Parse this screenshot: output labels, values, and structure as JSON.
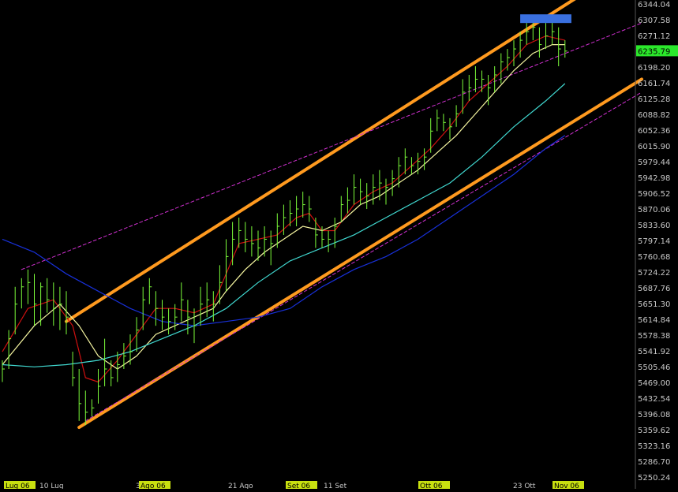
{
  "colors": {
    "background": "#000000",
    "price_bars": "#7CFC3A",
    "ma_fast": "#D01010",
    "ma_medium": "#F5F5A0",
    "ma_slow": "#40D8D0",
    "ma_long": "#1830D8",
    "channel": "#FF9A1F",
    "dashed_trend": "#D030D0",
    "axis_text": "#C8C8C8",
    "last_price_bg": "#2BE82B",
    "date_highlight_bg": "#C8E010",
    "target_box": "#3A70E0"
  },
  "chart_data": {
    "type": "line",
    "title": "",
    "xlabel": "",
    "ylabel": "",
    "ylim": [
      5250.24,
      6344.04
    ],
    "y_ticks": [
      "6344.04",
      "6307.58",
      "6271.12",
      "6235.79",
      "6198.20",
      "6161.74",
      "6125.28",
      "6088.82",
      "6052.36",
      "6015.90",
      "5979.44",
      "5942.98",
      "5906.52",
      "5870.06",
      "5833.60",
      "5797.14",
      "5760.68",
      "5724.22",
      "5687.76",
      "5651.30",
      "5614.84",
      "5578.38",
      "5541.92",
      "5505.46",
      "5469.00",
      "5432.54",
      "5396.08",
      "5359.62",
      "5323.16",
      "5286.70",
      "5250.24"
    ],
    "last_price": "6235.79",
    "x_tick_labels": [
      {
        "label": "Lug 06",
        "highlight": true
      },
      {
        "label": "10 Lug",
        "highlight": false
      },
      {
        "label": "31",
        "highlight": false
      },
      {
        "label": "Ago 06",
        "highlight": true
      },
      {
        "label": "21 Ago",
        "highlight": false
      },
      {
        "label": "Set 06",
        "highlight": true
      },
      {
        "label": "11 Set",
        "highlight": false
      },
      {
        "label": "Ott 06",
        "highlight": true
      },
      {
        "label": "23 Ott",
        "highlight": false
      },
      {
        "label": "Nov 06",
        "highlight": true
      }
    ],
    "x_range": [
      0,
      100
    ],
    "price_bars": [
      {
        "x": 0,
        "h": 5520,
        "l": 5470,
        "c": 5500
      },
      {
        "x": 1,
        "h": 5590,
        "l": 5500,
        "c": 5570
      },
      {
        "x": 2,
        "h": 5690,
        "l": 5580,
        "c": 5650
      },
      {
        "x": 3,
        "h": 5710,
        "l": 5640,
        "c": 5690
      },
      {
        "x": 4,
        "h": 5730,
        "l": 5650,
        "c": 5700
      },
      {
        "x": 5,
        "h": 5720,
        "l": 5600,
        "c": 5650
      },
      {
        "x": 6,
        "h": 5700,
        "l": 5600,
        "c": 5690
      },
      {
        "x": 7,
        "h": 5710,
        "l": 5630,
        "c": 5660
      },
      {
        "x": 8,
        "h": 5700,
        "l": 5600,
        "c": 5640
      },
      {
        "x": 9,
        "h": 5690,
        "l": 5590,
        "c": 5650
      },
      {
        "x": 10,
        "h": 5680,
        "l": 5580,
        "c": 5620
      },
      {
        "x": 11,
        "h": 5540,
        "l": 5460,
        "c": 5480
      },
      {
        "x": 12,
        "h": 5500,
        "l": 5380,
        "c": 5420
      },
      {
        "x": 13,
        "h": 5450,
        "l": 5370,
        "c": 5400
      },
      {
        "x": 14,
        "h": 5430,
        "l": 5390,
        "c": 5410
      },
      {
        "x": 15,
        "h": 5500,
        "l": 5420,
        "c": 5460
      },
      {
        "x": 16,
        "h": 5570,
        "l": 5460,
        "c": 5500
      },
      {
        "x": 17,
        "h": 5520,
        "l": 5460,
        "c": 5480
      },
      {
        "x": 18,
        "h": 5540,
        "l": 5470,
        "c": 5510
      },
      {
        "x": 19,
        "h": 5560,
        "l": 5500,
        "c": 5530
      },
      {
        "x": 20,
        "h": 5580,
        "l": 5510,
        "c": 5540
      },
      {
        "x": 21,
        "h": 5620,
        "l": 5540,
        "c": 5590
      },
      {
        "x": 22,
        "h": 5690,
        "l": 5590,
        "c": 5660
      },
      {
        "x": 23,
        "h": 5710,
        "l": 5650,
        "c": 5690
      },
      {
        "x": 24,
        "h": 5680,
        "l": 5600,
        "c": 5640
      },
      {
        "x": 25,
        "h": 5660,
        "l": 5590,
        "c": 5620
      },
      {
        "x": 26,
        "h": 5640,
        "l": 5580,
        "c": 5610
      },
      {
        "x": 27,
        "h": 5650,
        "l": 5590,
        "c": 5620
      },
      {
        "x": 28,
        "h": 5700,
        "l": 5610,
        "c": 5660
      },
      {
        "x": 29,
        "h": 5660,
        "l": 5580,
        "c": 5620
      },
      {
        "x": 30,
        "h": 5640,
        "l": 5560,
        "c": 5600
      },
      {
        "x": 31,
        "h": 5690,
        "l": 5600,
        "c": 5650
      },
      {
        "x": 32,
        "h": 5700,
        "l": 5620,
        "c": 5660
      },
      {
        "x": 33,
        "h": 5680,
        "l": 5610,
        "c": 5650
      },
      {
        "x": 34,
        "h": 5740,
        "l": 5650,
        "c": 5700
      },
      {
        "x": 35,
        "h": 5800,
        "l": 5680,
        "c": 5760
      },
      {
        "x": 36,
        "h": 5840,
        "l": 5740,
        "c": 5800
      },
      {
        "x": 37,
        "h": 5850,
        "l": 5780,
        "c": 5820
      },
      {
        "x": 38,
        "h": 5840,
        "l": 5770,
        "c": 5800
      },
      {
        "x": 39,
        "h": 5830,
        "l": 5760,
        "c": 5790
      },
      {
        "x": 40,
        "h": 5820,
        "l": 5750,
        "c": 5780
      },
      {
        "x": 41,
        "h": 5830,
        "l": 5760,
        "c": 5800
      },
      {
        "x": 42,
        "h": 5820,
        "l": 5740,
        "c": 5790
      },
      {
        "x": 43,
        "h": 5860,
        "l": 5780,
        "c": 5830
      },
      {
        "x": 44,
        "h": 5880,
        "l": 5810,
        "c": 5850
      },
      {
        "x": 45,
        "h": 5890,
        "l": 5830,
        "c": 5860
      },
      {
        "x": 46,
        "h": 5900,
        "l": 5830,
        "c": 5870
      },
      {
        "x": 47,
        "h": 5910,
        "l": 5850,
        "c": 5880
      },
      {
        "x": 48,
        "h": 5900,
        "l": 5840,
        "c": 5870
      },
      {
        "x": 49,
        "h": 5850,
        "l": 5780,
        "c": 5810
      },
      {
        "x": 50,
        "h": 5830,
        "l": 5780,
        "c": 5800
      },
      {
        "x": 51,
        "h": 5820,
        "l": 5770,
        "c": 5800
      },
      {
        "x": 52,
        "h": 5850,
        "l": 5780,
        "c": 5830
      },
      {
        "x": 53,
        "h": 5900,
        "l": 5840,
        "c": 5880
      },
      {
        "x": 54,
        "h": 5920,
        "l": 5860,
        "c": 5890
      },
      {
        "x": 55,
        "h": 5950,
        "l": 5880,
        "c": 5920
      },
      {
        "x": 56,
        "h": 5940,
        "l": 5880,
        "c": 5910
      },
      {
        "x": 57,
        "h": 5930,
        "l": 5870,
        "c": 5900
      },
      {
        "x": 58,
        "h": 5950,
        "l": 5880,
        "c": 5920
      },
      {
        "x": 59,
        "h": 5960,
        "l": 5890,
        "c": 5930
      },
      {
        "x": 60,
        "h": 5940,
        "l": 5880,
        "c": 5920
      },
      {
        "x": 61,
        "h": 5960,
        "l": 5900,
        "c": 5940
      },
      {
        "x": 62,
        "h": 5990,
        "l": 5920,
        "c": 5970
      },
      {
        "x": 63,
        "h": 6010,
        "l": 5950,
        "c": 5990
      },
      {
        "x": 64,
        "h": 5990,
        "l": 5950,
        "c": 5970
      },
      {
        "x": 65,
        "h": 6000,
        "l": 5950,
        "c": 5980
      },
      {
        "x": 66,
        "h": 6010,
        "l": 5960,
        "c": 5990
      },
      {
        "x": 67,
        "h": 6080,
        "l": 6000,
        "c": 6050
      },
      {
        "x": 68,
        "h": 6100,
        "l": 6050,
        "c": 6080
      },
      {
        "x": 69,
        "h": 6090,
        "l": 6050,
        "c": 6070
      },
      {
        "x": 70,
        "h": 6080,
        "l": 6030,
        "c": 6060
      },
      {
        "x": 71,
        "h": 6110,
        "l": 6060,
        "c": 6090
      },
      {
        "x": 72,
        "h": 6170,
        "l": 6090,
        "c": 6140
      },
      {
        "x": 73,
        "h": 6180,
        "l": 6120,
        "c": 6150
      },
      {
        "x": 74,
        "h": 6200,
        "l": 6140,
        "c": 6170
      },
      {
        "x": 75,
        "h": 6190,
        "l": 6140,
        "c": 6170
      },
      {
        "x": 76,
        "h": 6180,
        "l": 6110,
        "c": 6150
      },
      {
        "x": 77,
        "h": 6200,
        "l": 6140,
        "c": 6180
      },
      {
        "x": 78,
        "h": 6230,
        "l": 6160,
        "c": 6210
      },
      {
        "x": 79,
        "h": 6240,
        "l": 6190,
        "c": 6220
      },
      {
        "x": 80,
        "h": 6260,
        "l": 6200,
        "c": 6240
      },
      {
        "x": 81,
        "h": 6280,
        "l": 6220,
        "c": 6260
      },
      {
        "x": 82,
        "h": 6300,
        "l": 6250,
        "c": 6280
      },
      {
        "x": 83,
        "h": 6310,
        "l": 6260,
        "c": 6290
      },
      {
        "x": 84,
        "h": 6290,
        "l": 6220,
        "c": 6250
      },
      {
        "x": 85,
        "h": 6300,
        "l": 6240,
        "c": 6270
      },
      {
        "x": 86,
        "h": 6310,
        "l": 6250,
        "c": 6280
      },
      {
        "x": 87,
        "h": 6290,
        "l": 6200,
        "c": 6240
      },
      {
        "x": 88,
        "h": 6260,
        "l": 6220,
        "c": 6235
      }
    ],
    "series": [
      {
        "style": "ma_fast",
        "points": [
          [
            0,
            5540
          ],
          [
            4,
            5640
          ],
          [
            8,
            5660
          ],
          [
            11,
            5600
          ],
          [
            13,
            5480
          ],
          [
            15,
            5470
          ],
          [
            18,
            5520
          ],
          [
            21,
            5580
          ],
          [
            24,
            5640
          ],
          [
            27,
            5640
          ],
          [
            30,
            5630
          ],
          [
            33,
            5650
          ],
          [
            35,
            5720
          ],
          [
            37,
            5790
          ],
          [
            40,
            5800
          ],
          [
            43,
            5810
          ],
          [
            46,
            5850
          ],
          [
            48,
            5860
          ],
          [
            50,
            5820
          ],
          [
            52,
            5820
          ],
          [
            55,
            5880
          ],
          [
            58,
            5910
          ],
          [
            61,
            5930
          ],
          [
            64,
            5970
          ],
          [
            67,
            6010
          ],
          [
            70,
            6060
          ],
          [
            73,
            6120
          ],
          [
            76,
            6160
          ],
          [
            79,
            6200
          ],
          [
            82,
            6250
          ],
          [
            85,
            6270
          ],
          [
            88,
            6260
          ]
        ]
      },
      {
        "style": "ma_medium",
        "points": [
          [
            0,
            5510
          ],
          [
            5,
            5600
          ],
          [
            9,
            5650
          ],
          [
            12,
            5600
          ],
          [
            15,
            5530
          ],
          [
            18,
            5500
          ],
          [
            21,
            5530
          ],
          [
            24,
            5580
          ],
          [
            27,
            5600
          ],
          [
            30,
            5620
          ],
          [
            33,
            5640
          ],
          [
            35,
            5680
          ],
          [
            38,
            5730
          ],
          [
            41,
            5770
          ],
          [
            44,
            5800
          ],
          [
            47,
            5830
          ],
          [
            50,
            5820
          ],
          [
            53,
            5840
          ],
          [
            56,
            5880
          ],
          [
            59,
            5900
          ],
          [
            62,
            5930
          ],
          [
            65,
            5960
          ],
          [
            68,
            6000
          ],
          [
            71,
            6040
          ],
          [
            74,
            6090
          ],
          [
            77,
            6140
          ],
          [
            80,
            6190
          ],
          [
            83,
            6230
          ],
          [
            86,
            6250
          ],
          [
            88,
            6250
          ]
        ]
      },
      {
        "style": "ma_slow",
        "points": [
          [
            0,
            5510
          ],
          [
            5,
            5505
          ],
          [
            10,
            5510
          ],
          [
            15,
            5520
          ],
          [
            20,
            5540
          ],
          [
            25,
            5570
          ],
          [
            30,
            5600
          ],
          [
            35,
            5640
          ],
          [
            40,
            5700
          ],
          [
            45,
            5750
          ],
          [
            50,
            5780
          ],
          [
            55,
            5810
          ],
          [
            60,
            5850
          ],
          [
            65,
            5890
          ],
          [
            70,
            5930
          ],
          [
            75,
            5990
          ],
          [
            80,
            6060
          ],
          [
            85,
            6120
          ],
          [
            88,
            6160
          ]
        ]
      },
      {
        "style": "ma_long",
        "points": [
          [
            0,
            5800
          ],
          [
            5,
            5770
          ],
          [
            10,
            5720
          ],
          [
            15,
            5680
          ],
          [
            20,
            5640
          ],
          [
            25,
            5610
          ],
          [
            30,
            5600
          ],
          [
            35,
            5610
          ],
          [
            40,
            5620
          ],
          [
            45,
            5640
          ],
          [
            50,
            5690
          ],
          [
            55,
            5730
          ],
          [
            60,
            5760
          ],
          [
            65,
            5800
          ],
          [
            70,
            5850
          ],
          [
            75,
            5900
          ],
          [
            80,
            5950
          ],
          [
            85,
            6010
          ],
          [
            88,
            6040
          ]
        ]
      }
    ],
    "trendlines": [
      {
        "style": "channel",
        "x1": 10,
        "y1": 5610,
        "x2": 90,
        "y2": 6360
      },
      {
        "style": "channel",
        "x1": 12,
        "y1": 5365,
        "x2": 100,
        "y2": 6170
      },
      {
        "style": "dashed_trend",
        "x1": 3,
        "y1": 5730,
        "x2": 100,
        "y2": 6300
      },
      {
        "style": "dashed_trend",
        "x1": 13,
        "y1": 5380,
        "x2": 100,
        "y2": 6140
      }
    ],
    "target_zone": {
      "x1": 81,
      "x2": 89,
      "y_low": 6300,
      "y_high": 6320
    }
  }
}
